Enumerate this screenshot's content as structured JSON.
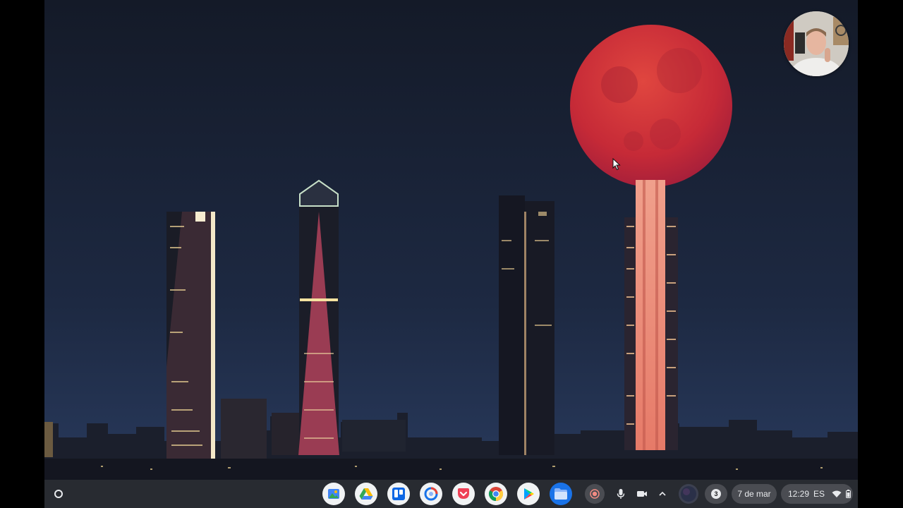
{
  "colors": {
    "sky_top": "#151c2b",
    "sky_bottom": "#253454",
    "moon": "#c8283a",
    "shelf_bg": "#282a2e",
    "tray_text": "#e8eaed"
  },
  "shelf": {
    "launcher_icon": "launcher-ring-icon",
    "apps": [
      {
        "name": "app-google-photos",
        "icon": "photos-icon"
      },
      {
        "name": "app-google-drive",
        "icon": "drive-icon"
      },
      {
        "name": "app-trello",
        "icon": "trello-icon"
      },
      {
        "name": "app-chromebook-helper",
        "icon": "blue-circle-icon"
      },
      {
        "name": "app-pocket",
        "icon": "pocket-icon"
      },
      {
        "name": "app-chrome",
        "icon": "chrome-icon"
      },
      {
        "name": "app-play-store",
        "icon": "play-store-icon"
      },
      {
        "name": "app-files",
        "icon": "files-folder-icon"
      }
    ],
    "tray": {
      "notification_count": "3",
      "date": "7 de mar",
      "time": "12:29",
      "input_method": "ES"
    }
  }
}
